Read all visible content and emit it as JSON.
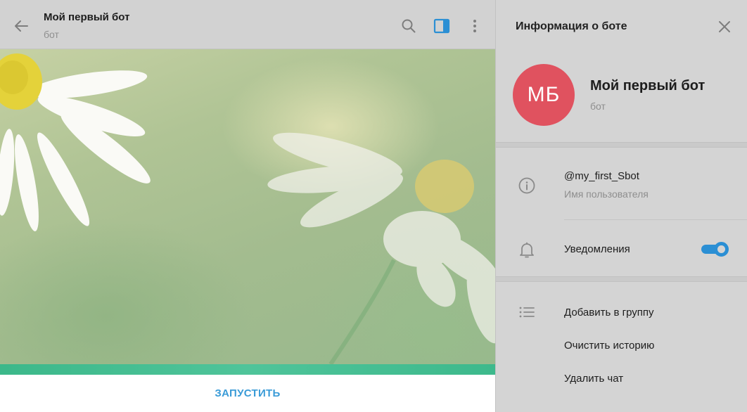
{
  "chat": {
    "title": "Мой первый бот",
    "subtitle": "бот",
    "start_button": "ЗАПУСТИТЬ",
    "icons": [
      "back-arrow-icon",
      "search-icon",
      "sidebar-toggle-icon",
      "more-vertical-icon"
    ],
    "accent": "#3a9bd7"
  },
  "panel": {
    "title": "Информация о боте",
    "avatar_initials": "МБ",
    "avatar_color": "#e0525f",
    "bot_name": "Мой первый бот",
    "bot_type": "бот",
    "username": "@my_first_Sbot",
    "username_label": "Имя пользователя",
    "notifications_label": "Уведомления",
    "notifications_on": true,
    "actions": [
      "Добавить в группу",
      "Очистить историю",
      "Удалить чат"
    ],
    "icons": [
      "close-icon",
      "info-icon",
      "bell-icon",
      "list-icon"
    ]
  }
}
